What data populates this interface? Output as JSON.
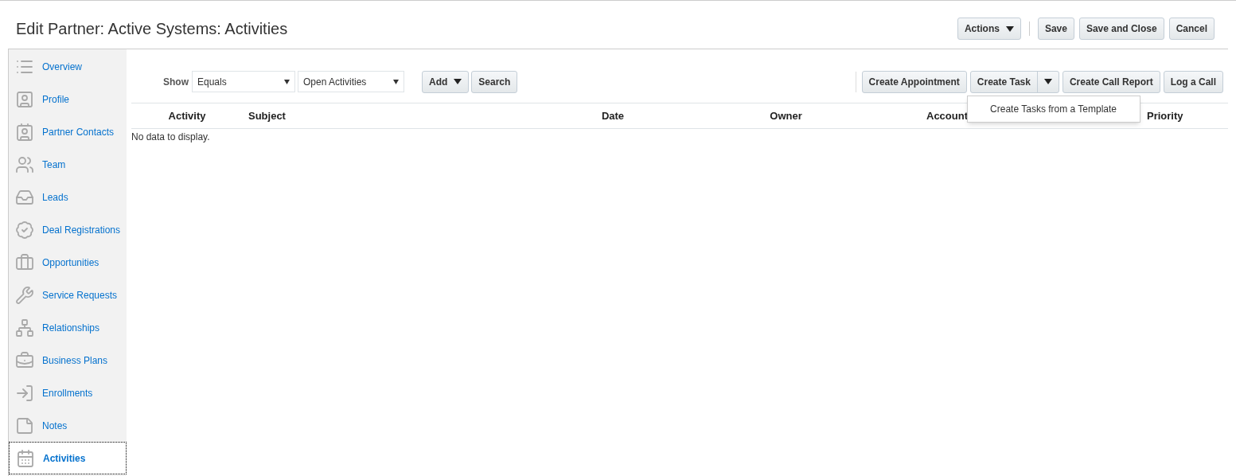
{
  "title": "Edit Partner: Active Systems: Activities",
  "header_buttons": [
    {
      "label": "Actions",
      "kind": "menu"
    },
    {
      "label": "Save",
      "kind": "plain"
    },
    {
      "label": "Save and Close",
      "kind": "plain"
    },
    {
      "label": "Cancel",
      "kind": "plain"
    }
  ],
  "sidebar": {
    "items": [
      {
        "label": "Overview",
        "selected": false
      },
      {
        "label": "Profile",
        "selected": false
      },
      {
        "label": "Partner Contacts",
        "selected": false
      },
      {
        "label": "Team",
        "selected": false
      },
      {
        "label": "Leads",
        "selected": false
      },
      {
        "label": "Deal Registrations",
        "selected": false
      },
      {
        "label": "Opportunities",
        "selected": false
      },
      {
        "label": "Service Requests",
        "selected": false
      },
      {
        "label": "Relationships",
        "selected": false
      },
      {
        "label": "Business Plans",
        "selected": false
      },
      {
        "label": "Enrollments",
        "selected": false
      },
      {
        "label": "Notes",
        "selected": false
      },
      {
        "label": "Activities",
        "selected": true
      }
    ]
  },
  "filter": {
    "label": "Show",
    "operator": "Equals",
    "value": "Open Activities"
  },
  "toolbar_left": [
    {
      "label": "Add",
      "kind": "menu"
    },
    {
      "label": "Search",
      "kind": "plain"
    }
  ],
  "toolbar_right": [
    {
      "label": "Create Appointment",
      "kind": "plain"
    },
    {
      "label": "Create Task",
      "kind": "split"
    },
    {
      "label": "Create Call Report",
      "kind": "plain"
    },
    {
      "label": "Log a Call",
      "kind": "plain"
    }
  ],
  "menu": {
    "items": [
      "Create Tasks from a Template"
    ]
  },
  "table": {
    "columns": [
      "Activity",
      "Subject",
      "Date",
      "Owner",
      "Account",
      "Priority"
    ],
    "empty_text": "No data to display."
  }
}
